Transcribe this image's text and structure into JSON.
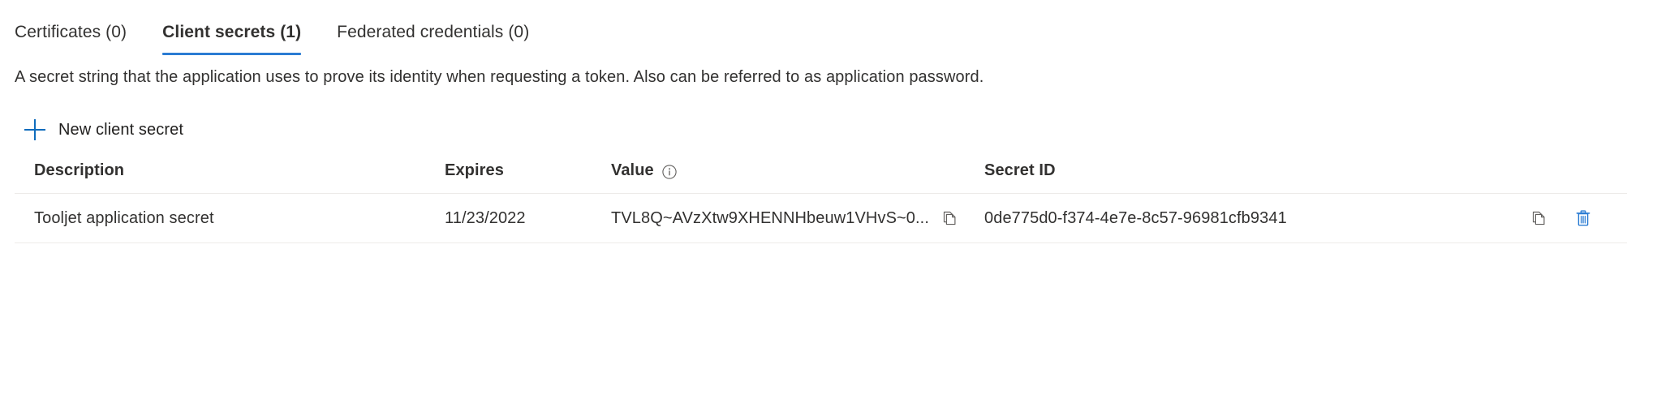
{
  "tabs": [
    {
      "label": "Certificates (0)",
      "active": false,
      "name": "tab-certificates"
    },
    {
      "label": "Client secrets (1)",
      "active": true,
      "name": "tab-client-secrets"
    },
    {
      "label": "Federated credentials (0)",
      "active": false,
      "name": "tab-federated-credentials"
    }
  ],
  "description": "A secret string that the application uses to prove its identity when requesting a token. Also can be referred to as application password.",
  "commandbar": {
    "new_secret_label": "New client secret",
    "plus_icon": "plus-icon"
  },
  "table": {
    "headers": {
      "description": "Description",
      "expires": "Expires",
      "value": "Value",
      "value_info_icon": "info-circle-icon",
      "secret_id": "Secret ID"
    },
    "rows": [
      {
        "description": "Tooljet application secret",
        "expires": "11/23/2022",
        "value": "TVL8Q~AVzXtw9XHENNHbeuw1VHvS~0...",
        "value_copy_icon": "copy-icon",
        "secret_id": "0de775d0-f374-4e7e-8c57-96981cfb9341",
        "secret_copy_icon": "copy-icon",
        "delete_icon": "trash-icon"
      }
    ]
  },
  "colors": {
    "accent": "#2b7cd3",
    "link": "#0f6cbd",
    "delete": "#2b7cd3",
    "text": "#323130",
    "divider": "#edebe9",
    "icon_gray": "#605e5c"
  }
}
